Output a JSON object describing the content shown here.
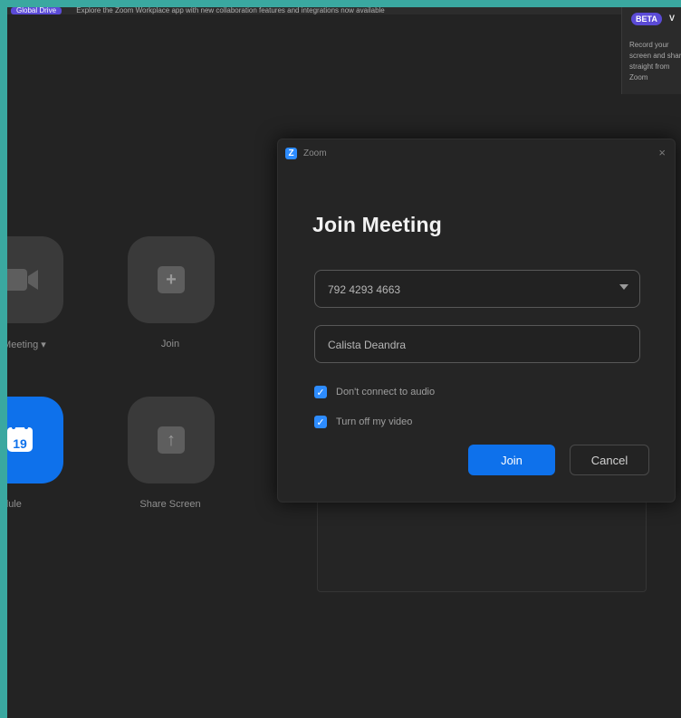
{
  "banner": {
    "pill": "Global Drive",
    "message": "Explore the Zoom Workplace app with new collaboration features and integrations now available"
  },
  "beta_card": {
    "badge": "BETA",
    "title_initial": "V",
    "description": "Record your screen and share straight from Zoom"
  },
  "home": {
    "tiles": [
      {
        "label": "New Meeting ▾",
        "icon": "video-camera-icon"
      },
      {
        "label": "Join",
        "icon": "plus-icon"
      },
      {
        "label": "Schedule",
        "icon": "calendar-icon",
        "day": "19"
      },
      {
        "label": "Share Screen",
        "icon": "share-up-arrow-icon"
      }
    ]
  },
  "dialog": {
    "app_name": "Zoom",
    "logo_letter": "Z",
    "close": "×",
    "title": "Join Meeting",
    "meeting_id_value": "792 4293 4663",
    "name_value": "Calista Deandra",
    "options": [
      {
        "label": "Don't connect to audio",
        "checked": true
      },
      {
        "label": "Turn off my video",
        "checked": true
      }
    ],
    "join_label": "Join",
    "cancel_label": "Cancel"
  },
  "colors": {
    "accent_blue": "#0e71eb",
    "dialog_bg": "#252525",
    "app_bg": "#232323",
    "outer_frame": "#3aa8a0"
  }
}
